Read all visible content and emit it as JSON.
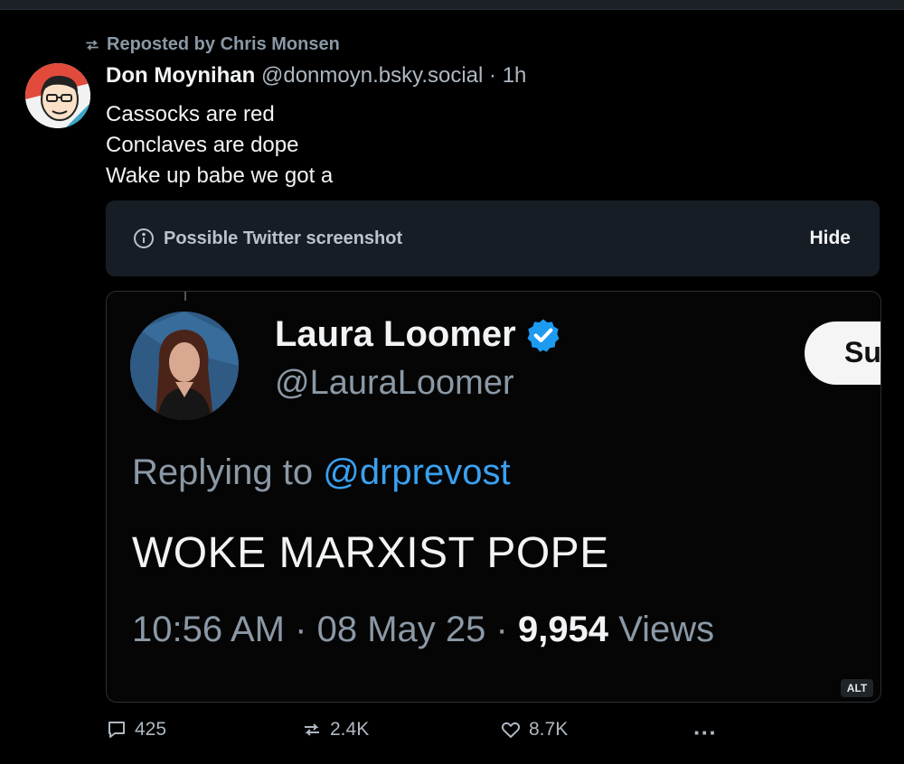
{
  "repost": {
    "label": "Reposted by Chris Monsen"
  },
  "post": {
    "author_name": "Don Moynihan",
    "author_handle": "@donmoyn.bsky.social",
    "separator": "·",
    "time": "1h",
    "lines": [
      "Cassocks are red",
      "Conclaves are dope",
      "Wake up babe we got a"
    ]
  },
  "warning": {
    "label": "Possible Twitter screenshot",
    "hide_label": "Hide"
  },
  "embedded_tweet": {
    "name": "Laura Loomer",
    "handle": "@LauraLoomer",
    "subscribe_label": "Su",
    "replying_prefix": "Replying to",
    "replying_handle": "@drprevost",
    "text": "WOKE MARXIST POPE",
    "time": "10:56 AM",
    "date": "08 May 25",
    "views_count": "9,954",
    "views_label": "Views",
    "separator": "·",
    "alt_badge": "ALT"
  },
  "actions": {
    "replies": "425",
    "reposts": "2.4K",
    "likes": "8.7K",
    "more": "···"
  },
  "colors": {
    "background": "#000000",
    "muted": "#8b98a5",
    "mention": "#3aa0f0",
    "verified": "#1d9bf0"
  }
}
